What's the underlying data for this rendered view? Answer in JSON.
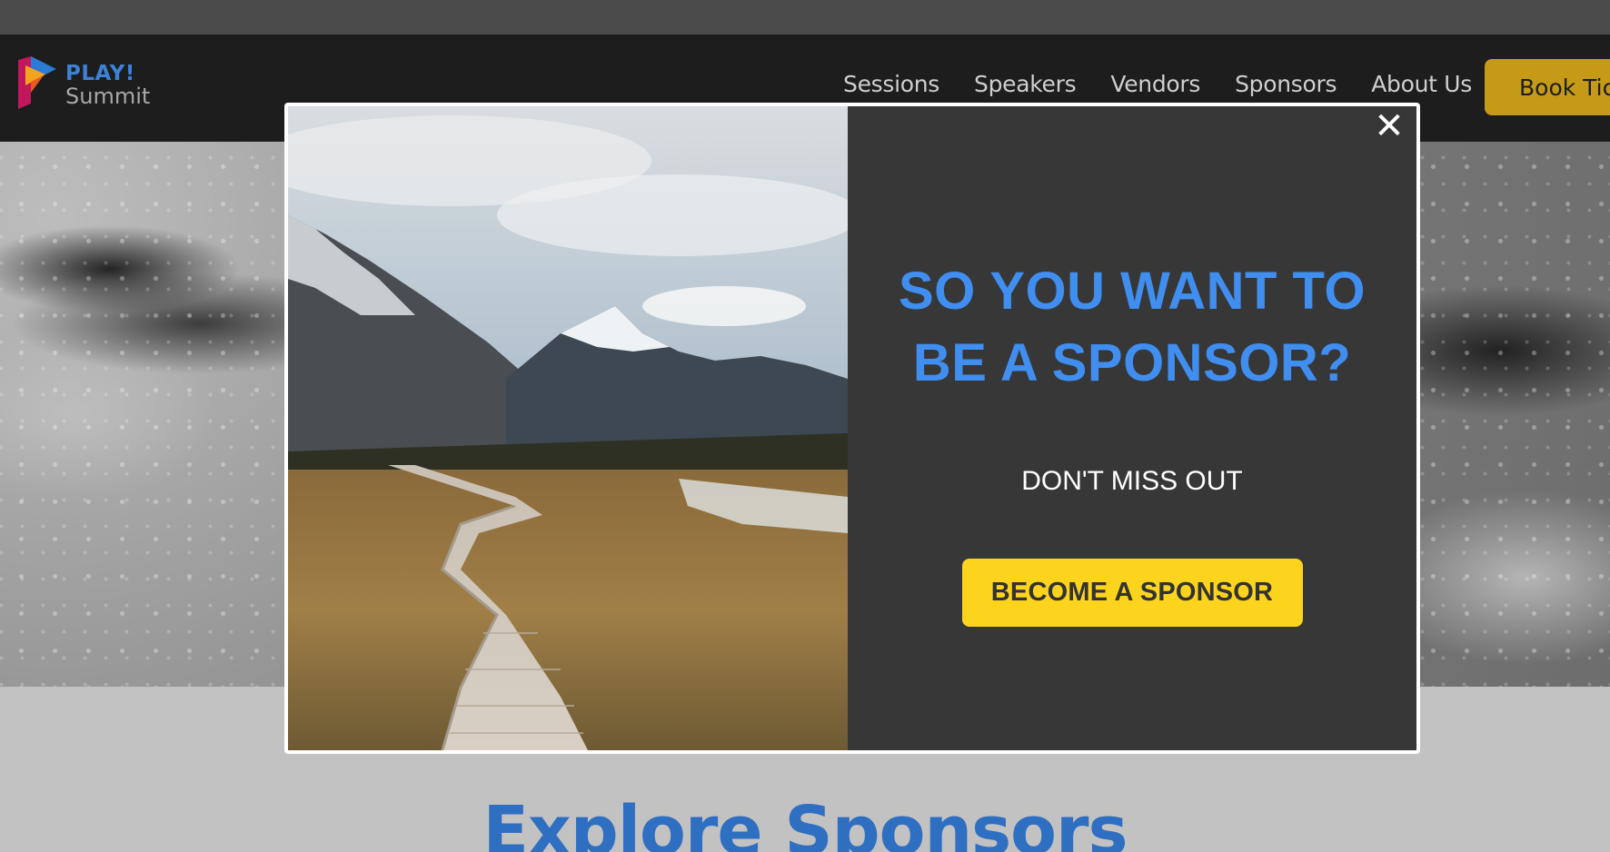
{
  "header": {
    "logo_line1": "PLAY!",
    "logo_line2": "Summit",
    "nav": [
      "Sessions",
      "Speakers",
      "Vendors",
      "Sponsors",
      "About Us"
    ],
    "book_button": "Book Tic"
  },
  "main": {
    "section_title": "Explore Sponsors"
  },
  "modal": {
    "close_symbol": "✕",
    "headline": "SO YOU WANT TO BE A SPONSOR?",
    "subtext": "DON'T MISS OUT",
    "cta_label": "BECOME A SPONSOR"
  },
  "colors": {
    "brand_blue": "#3f8ef0",
    "cta_yellow": "#fdd41d",
    "header_bg": "#1d1d1d",
    "modal_panel": "#373737",
    "book_button": "#c49a17"
  },
  "icons": {
    "logo": "play-summit-logo-icon",
    "close": "close-icon"
  }
}
